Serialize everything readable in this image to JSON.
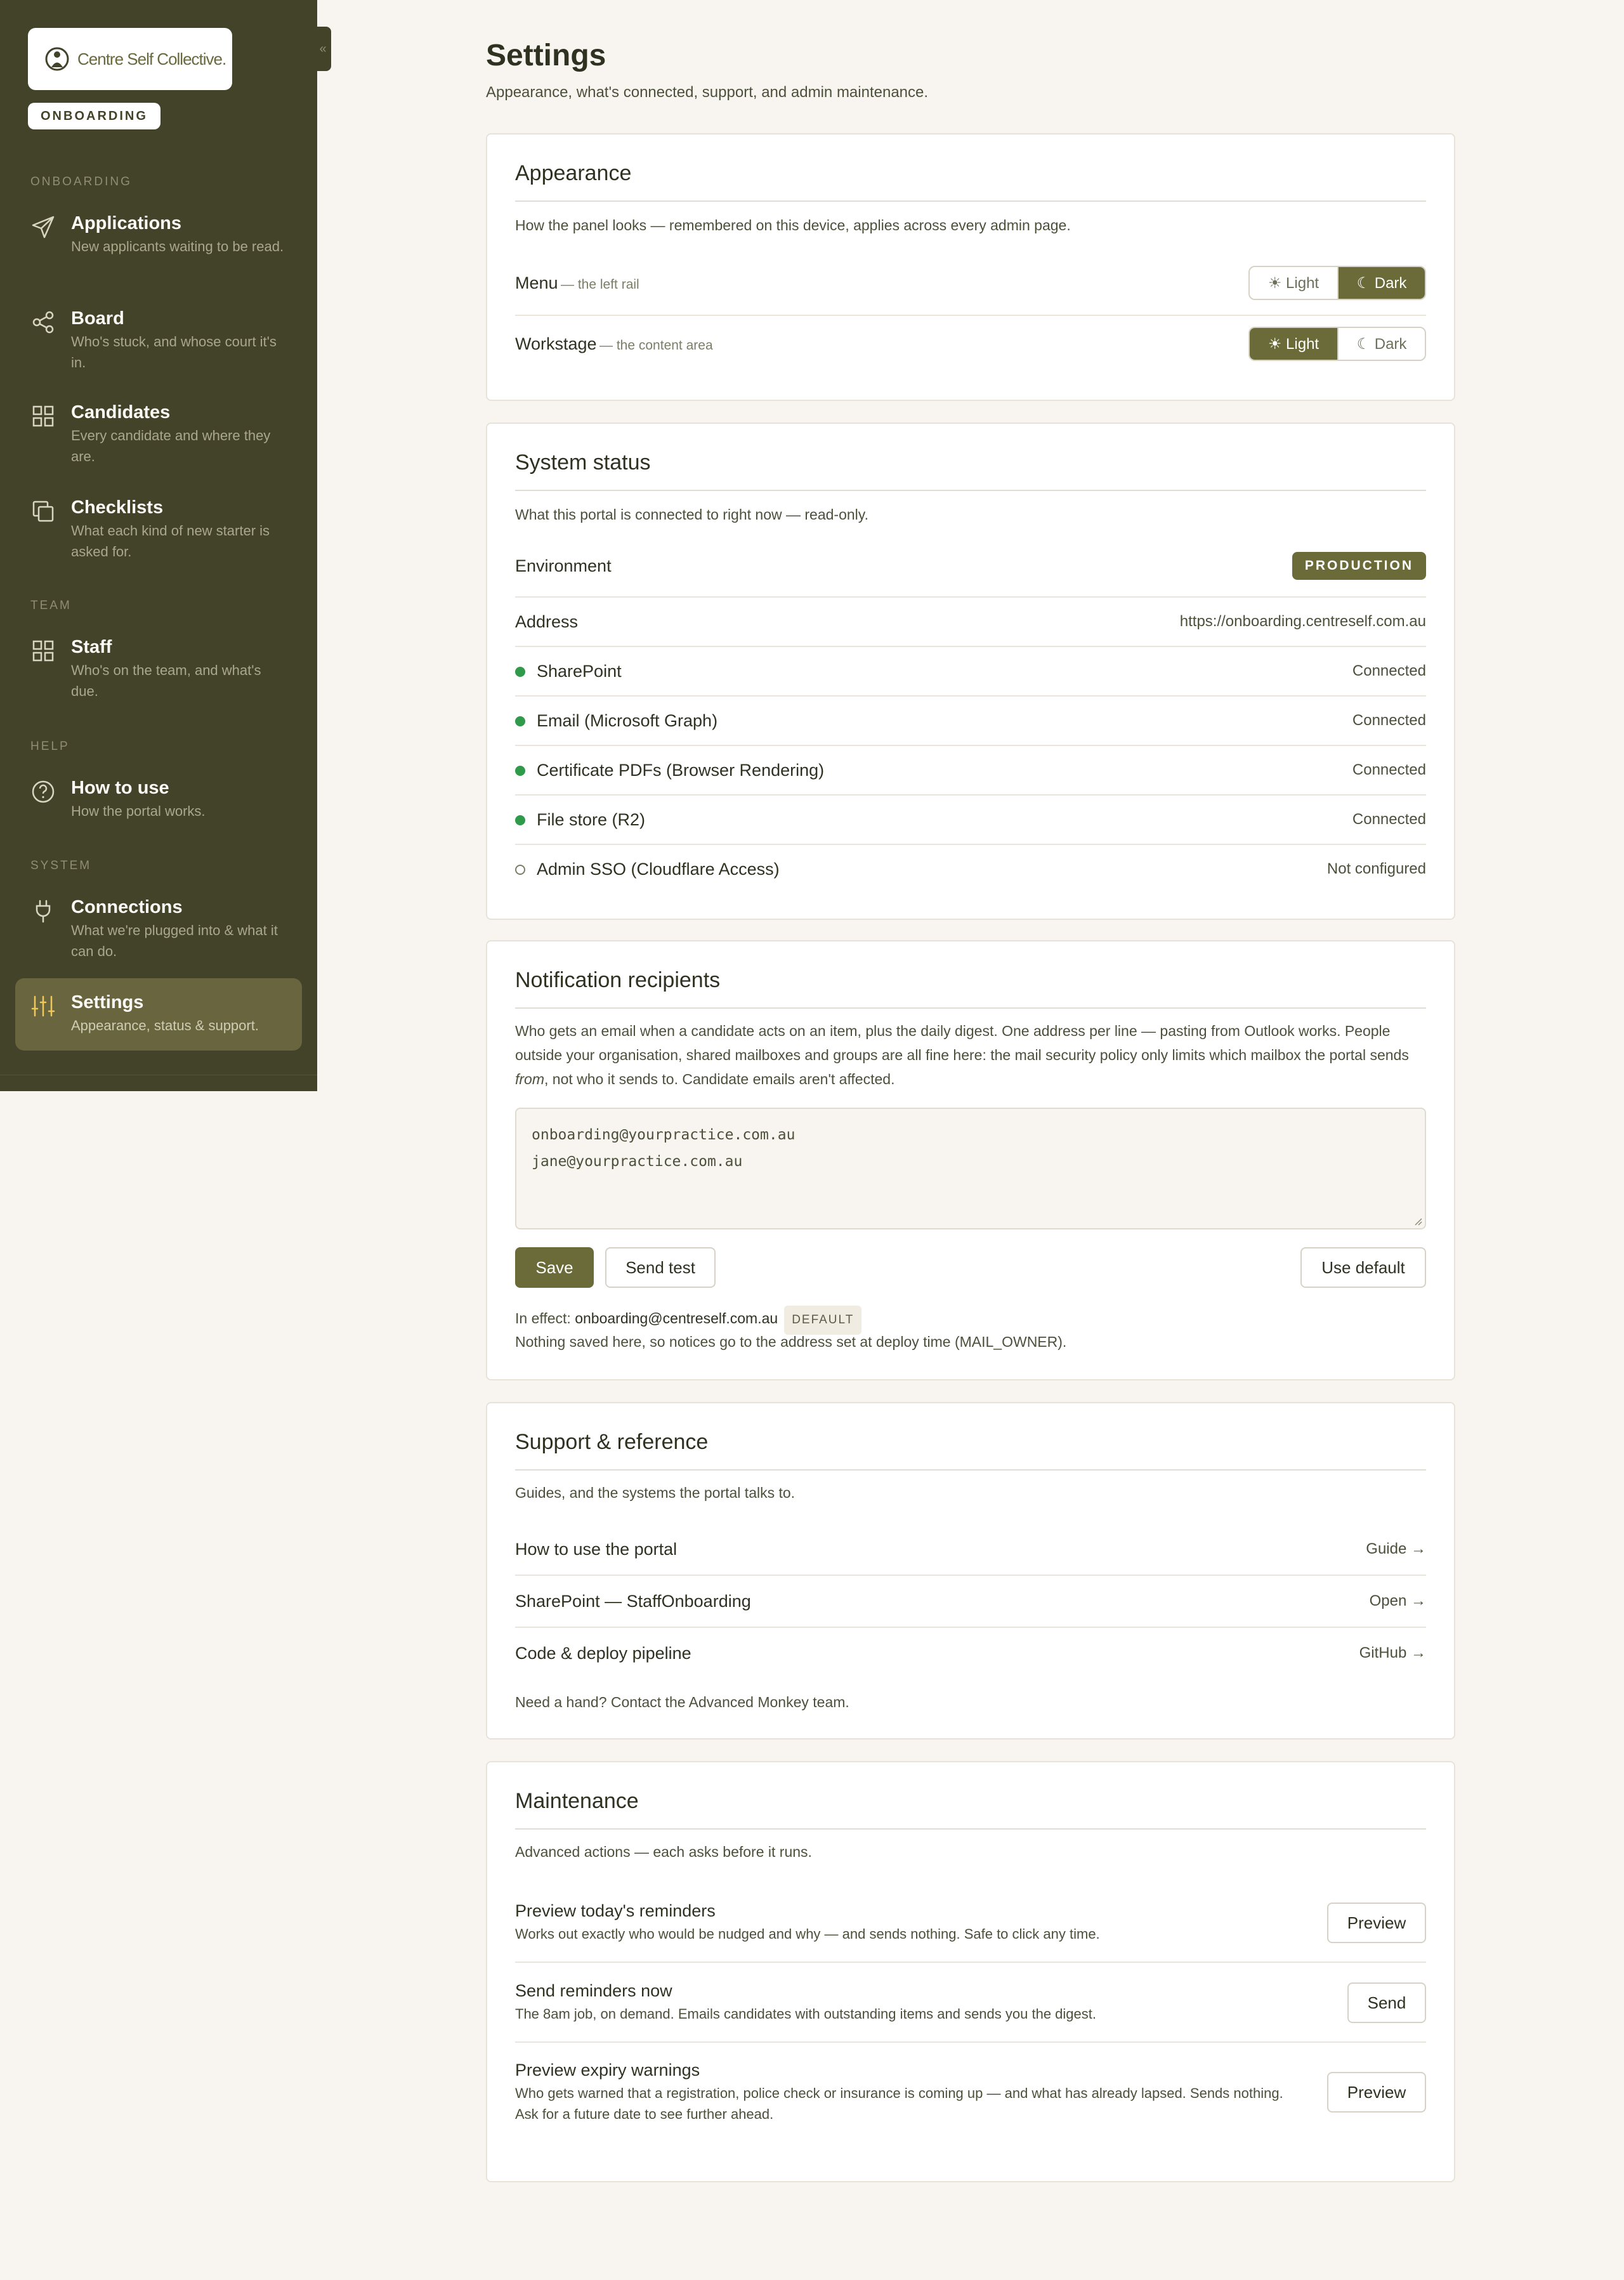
{
  "sidebar": {
    "logo_text": "Centre Self Collective.",
    "app_badge": "ONBOARDING",
    "collapse_glyph": "«",
    "sections": {
      "onboarding": "ONBOARDING",
      "team": "TEAM",
      "help": "HELP",
      "system": "SYSTEM"
    },
    "items": [
      {
        "title": "Applications",
        "subtitle": "New applicants waiting to be read.",
        "icon": "send-icon"
      },
      {
        "title": "Board",
        "subtitle": "Who's stuck, and whose court it's in.",
        "icon": "share-icon"
      },
      {
        "title": "Candidates",
        "subtitle": "Every candidate and where they are.",
        "icon": "grid-icon"
      },
      {
        "title": "Checklists",
        "subtitle": "What each kind of new starter is asked for.",
        "icon": "copy-icon"
      },
      {
        "title": "Staff",
        "subtitle": "Who's on the team, and what's due.",
        "icon": "grid-icon"
      },
      {
        "title": "How to use",
        "subtitle": "How the portal works.",
        "icon": "help-circle-icon"
      },
      {
        "title": "Connections",
        "subtitle": "What we're plugged into & what it can do.",
        "icon": "plug-icon"
      },
      {
        "title": "Settings",
        "subtitle": "Appearance, status & support.",
        "icon": "sliders-icon",
        "active": true
      }
    ]
  },
  "page": {
    "title": "Settings",
    "subtitle": "Appearance, what's connected, support, and admin maintenance."
  },
  "appearance": {
    "title": "Appearance",
    "description": "How the panel looks — remembered on this device, applies across every admin page.",
    "menu_label": "Menu",
    "menu_hint": "— the left rail",
    "workstage_label": "Workstage",
    "workstage_hint": "— the content area",
    "light": "☀ Light",
    "dark": "☾ Dark",
    "menu_selected": "Dark",
    "workstage_selected": "Light"
  },
  "system_status": {
    "title": "System status",
    "description": "What this portal is connected to right now — read-only.",
    "environment_label": "Environment",
    "environment_value": "PRODUCTION",
    "address_label": "Address",
    "address_value": "https://onboarding.centreself.com.au",
    "services": [
      {
        "name": "SharePoint",
        "status": "Connected",
        "ok": true
      },
      {
        "name": "Email (Microsoft Graph)",
        "status": "Connected",
        "ok": true
      },
      {
        "name": "Certificate PDFs (Browser Rendering)",
        "status": "Connected",
        "ok": true
      },
      {
        "name": "File store (R2)",
        "status": "Connected",
        "ok": true
      },
      {
        "name": "Admin SSO (Cloudflare Access)",
        "status": "Not configured",
        "ok": false
      }
    ],
    "colors": {
      "connected": "#2f9a4a"
    }
  },
  "notifications": {
    "title": "Notification recipients",
    "description_1": "Who gets an email when a candidate acts on an item, plus the daily digest. One address per line — pasting from Outlook works. People outside your organisation, shared mailboxes and groups are all fine here: the mail security policy only limits which mailbox the portal sends ",
    "description_em": "from",
    "description_2": ", not who it sends to. Candidate emails aren't affected.",
    "recipients_line_1": "onboarding@yourpractice.com.au",
    "recipients_line_2": "jane@yourpractice.com.au",
    "save": "Save",
    "send_test": "Send test",
    "use_default": "Use default",
    "in_effect_label": "In effect:",
    "in_effect_value": "onboarding@centreself.com.au",
    "default_chip": "DEFAULT",
    "note": "Nothing saved here, so notices go to the address set at deploy time (MAIL_OWNER)."
  },
  "support": {
    "title": "Support & reference",
    "description": "Guides, and the systems the portal talks to.",
    "links": [
      {
        "label": "How to use the portal",
        "action": "Guide →"
      },
      {
        "label": "SharePoint — StaffOnboarding",
        "action": "Open →"
      },
      {
        "label": "Code & deploy pipeline",
        "action": "GitHub →"
      }
    ],
    "footer": "Need a hand? Contact the Advanced Monkey team."
  },
  "maintenance": {
    "title": "Maintenance",
    "description": "Advanced actions — each asks before it runs.",
    "actions": [
      {
        "title": "Preview today's reminders",
        "subtitle": "Works out exactly who would be nudged and why — and sends nothing. Safe to click any time.",
        "button": "Preview"
      },
      {
        "title": "Send reminders now",
        "subtitle": "The 8am job, on demand. Emails candidates with outstanding items and sends you the digest.",
        "button": "Send"
      },
      {
        "title": "Preview expiry warnings",
        "subtitle": "Who gets warned that a registration, police check or insurance is coming up — and what has already lapsed. Sends nothing. Ask for a future date to see further ahead.",
        "button": "Preview"
      }
    ]
  },
  "theme": {
    "sidebar_bg": "#43432a",
    "accent": "#6b6b3a",
    "page_bg": "#f8f5f0"
  }
}
